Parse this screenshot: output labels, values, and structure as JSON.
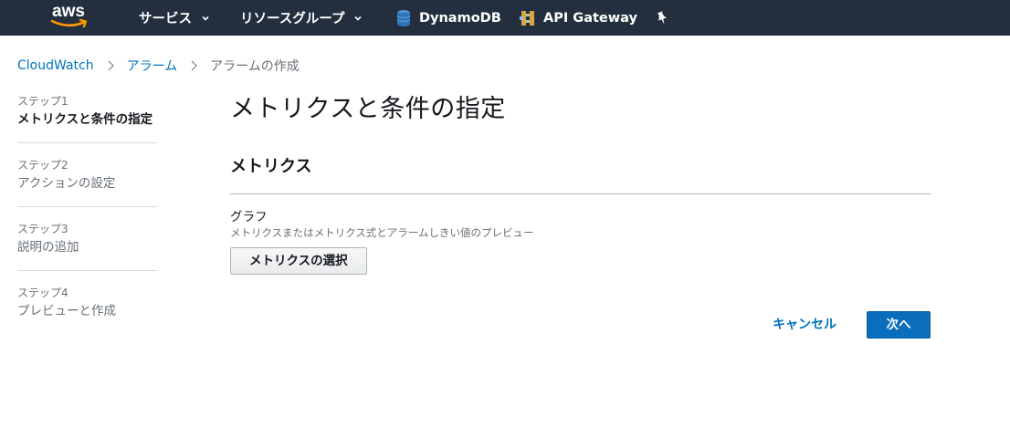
{
  "topnav": {
    "logo_text": "aws",
    "services_label": "サービス",
    "resource_groups_label": "リソースグループ",
    "dynamodb_label": "DynamoDB",
    "apigateway_label": "API Gateway",
    "colors": {
      "background": "#232f3e",
      "smile": "#ff9900"
    }
  },
  "breadcrumb": {
    "items": [
      "CloudWatch",
      "アラーム",
      "アラームの作成"
    ]
  },
  "steps": [
    {
      "number": "ステップ1",
      "title": "メトリクスと条件の指定",
      "active": true
    },
    {
      "number": "ステップ2",
      "title": "アクションの設定",
      "active": false
    },
    {
      "number": "ステップ3",
      "title": "説明の追加",
      "active": false
    },
    {
      "number": "ステップ4",
      "title": "プレビューと作成",
      "active": false
    }
  ],
  "main": {
    "page_title": "メトリクスと条件の指定",
    "section_title": "メトリクス",
    "graph_label": "グラフ",
    "graph_description": "メトリクスまたはメトリクス式とアラームしきい値のプレビュー",
    "select_metric_button": "メトリクスの選択"
  },
  "footer": {
    "cancel_label": "キャンセル",
    "next_label": "次へ",
    "colors": {
      "primary": "#0a6ebd",
      "link": "#0073bb"
    }
  }
}
